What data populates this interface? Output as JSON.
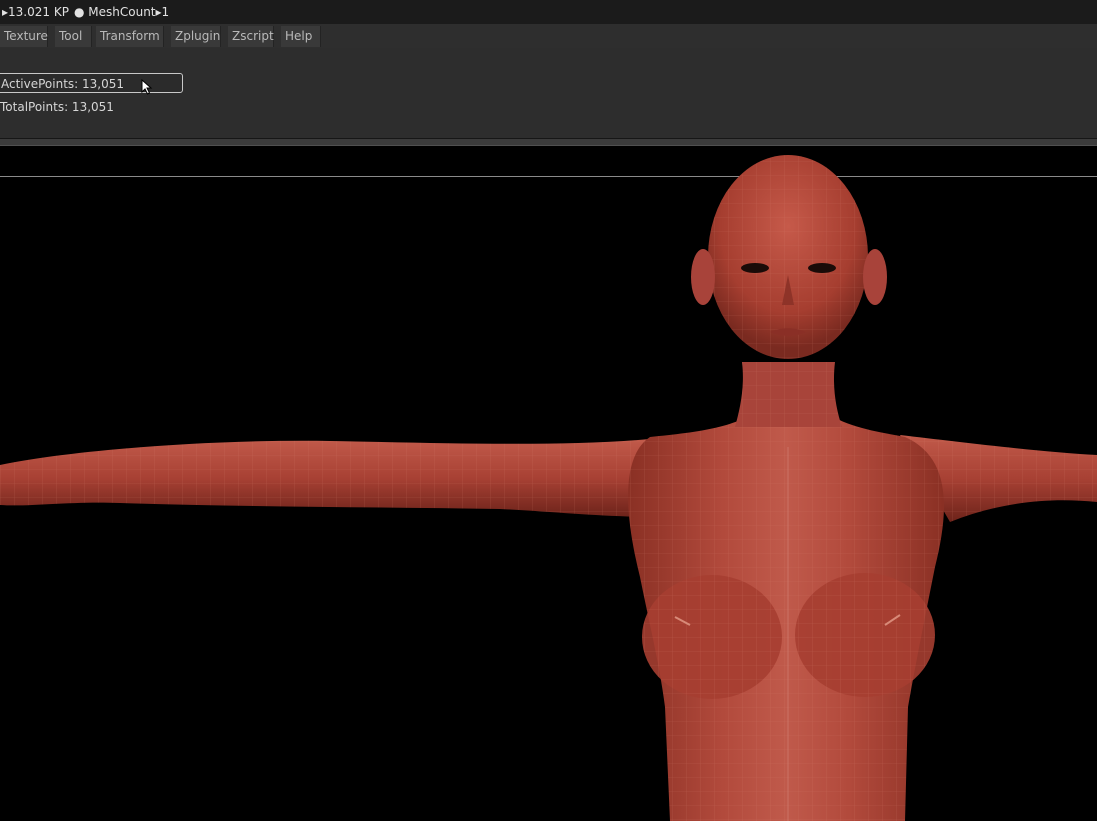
{
  "status_bar": {
    "active_points": "▸13.021 KP",
    "mesh_count": "● MeshCount▸1"
  },
  "menu": {
    "items": [
      "Texture",
      "Tool",
      "Transform",
      "Zplugin",
      "Zscript",
      "Help"
    ]
  },
  "info_panel": {
    "active_points_label": "ActivePoints: 13,051",
    "total_points_label": "TotalPoints: 13,051"
  },
  "canvas": {
    "background_color": "#000000",
    "model_color": "#b0473a",
    "model_highlight": "#c9685a",
    "model_shadow": "#6a2219",
    "wire_color": "#d98676"
  },
  "icons": {
    "cursor": "pointer-cursor-icon"
  }
}
